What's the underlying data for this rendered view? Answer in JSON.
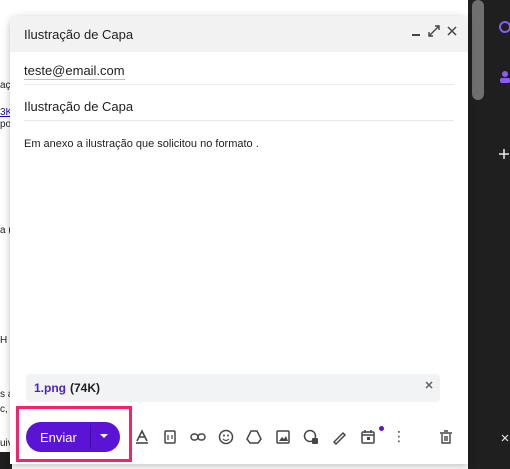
{
  "compose": {
    "title": "Ilustração de Capa",
    "header_controls": {
      "minimize": "▁",
      "popout": "⤢",
      "close": "✕"
    },
    "to": "teste@email.com",
    "subject": "Ilustração de Capa",
    "body": "Em anexo a ilustração que solicitou no formato ."
  },
  "attachment": {
    "name": "1.png",
    "size": "(74K)",
    "remove": "✕"
  },
  "send": {
    "label": "Enviar",
    "arrow": "▼"
  },
  "toolbar": {
    "more": "⋮",
    "icons": [
      "format-text-icon",
      "attach-file-icon",
      "insert-link-icon",
      "emoji-icon",
      "drive-icon",
      "insert-photo-icon",
      "confidential-mode-icon",
      "signature-icon",
      "schedule-send-icon",
      "more-options-icon",
      "discard-icon"
    ]
  },
  "background_fragments": [
    "aç",
    "3K",
    "poi",
    "a (",
    "H",
    "s a",
    "c,",
    "uiv"
  ],
  "colors": {
    "accent": "#5b14d6",
    "highlight": "#f0256e",
    "link": "#4b1fd1"
  }
}
